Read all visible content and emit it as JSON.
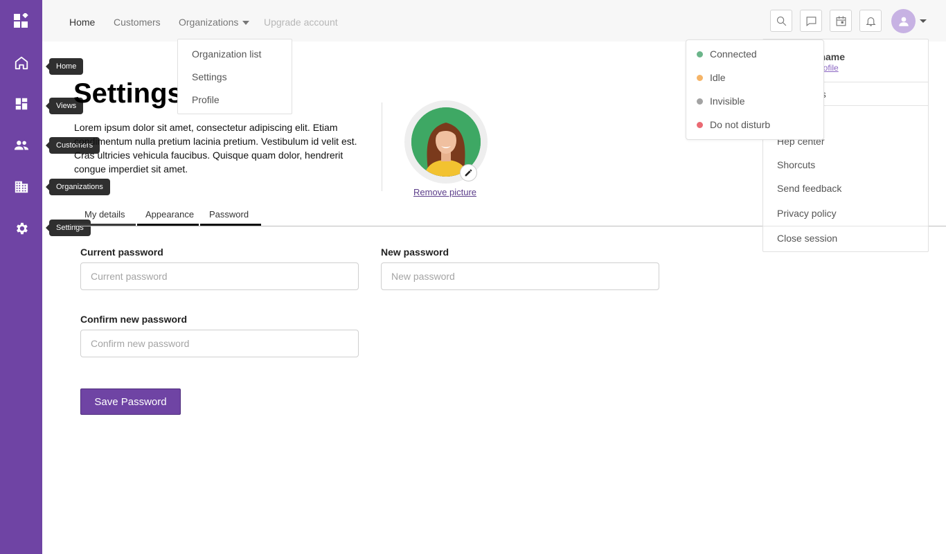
{
  "sidebar": {
    "items": [
      {
        "name": "home",
        "icon": "home-icon",
        "tooltip": "Home"
      },
      {
        "name": "views",
        "icon": "dashboard-icon",
        "tooltip": "Views"
      },
      {
        "name": "customers",
        "icon": "people-icon",
        "tooltip": "Customers"
      },
      {
        "name": "organizations",
        "icon": "building-icon",
        "tooltip": "Organizations"
      },
      {
        "name": "settings",
        "icon": "gear-icon",
        "tooltip": "Settings"
      }
    ]
  },
  "topnav": {
    "home": "Home",
    "customers": "Customers",
    "organizations": "Organizations",
    "upgrade": "Upgrade account",
    "icons": [
      "search-icon",
      "chat-icon",
      "calendar-icon",
      "bell-icon"
    ]
  },
  "org_menu": {
    "items": [
      "Organization list",
      "Settings",
      "Profile"
    ]
  },
  "page": {
    "title": "Settings",
    "intro": "Lorem ipsum dolor sit amet, consectetur adipiscing elit. Etiam condimentum nulla pretium lacinia pretium. Vestibulum id velit est. Cras ultricies vehicula faucibus. Quisque quam dolor, hendrerit congue imperdiet sit amet.",
    "remove_picture": "Remove picture"
  },
  "tabs": [
    "My details",
    "Appearance",
    "Password"
  ],
  "form": {
    "current_label": "Current password",
    "current_placeholder": "Current password",
    "new_label": "New password",
    "new_placeholder": "New password",
    "confirm_label": "Confirm new password",
    "confirm_placeholder": "Confirm new password",
    "save": "Save Password"
  },
  "user_menu": {
    "name_visible": "rname",
    "link_visible": "profile",
    "preferences_visible": "es",
    "help": "Hep center",
    "shortcuts": "Shorcuts",
    "feedback": "Send feedback",
    "privacy": "Privacy policy",
    "close": "Close session"
  },
  "status_menu": {
    "items": [
      {
        "label": "Connected",
        "color": "#6bb58a"
      },
      {
        "label": "Idle",
        "color": "#f5b467"
      },
      {
        "label": "Invisible",
        "color": "#a3a3a3"
      },
      {
        "label": "Do not disturb",
        "color": "#ea6a73"
      }
    ]
  },
  "colors": {
    "brand": "#6f44a4",
    "avatar_bg": "#c7b2e3"
  }
}
